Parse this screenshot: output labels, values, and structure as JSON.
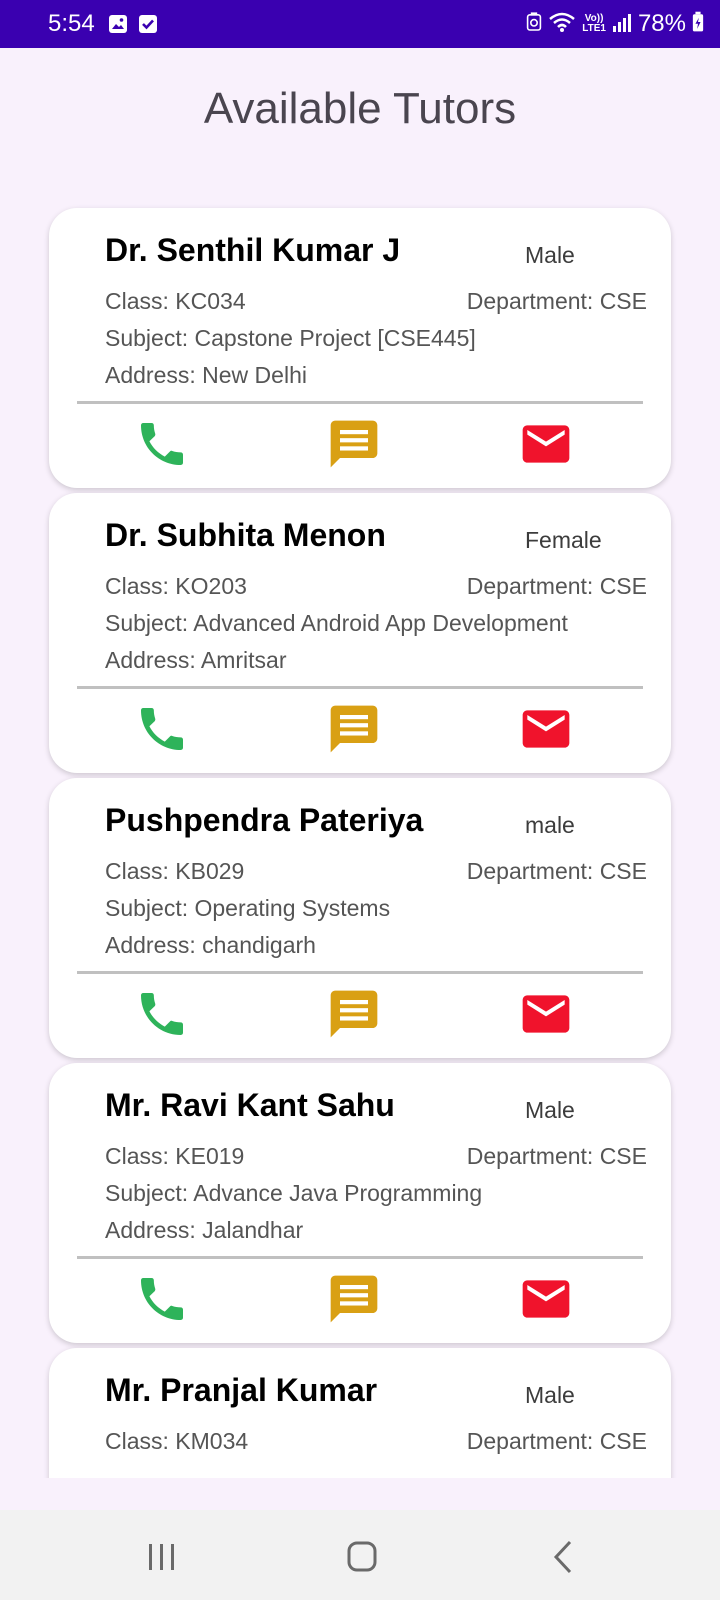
{
  "status_bar": {
    "time": "5:54",
    "left_icons": [
      "image-icon",
      "checkbox-icon"
    ],
    "network_label_top": "Vo))",
    "network_label_bottom": "LTE1",
    "battery": "78%"
  },
  "header": {
    "title": "Available Tutors"
  },
  "colors": {
    "status_bar": "#3a00b0",
    "background": "#f9f1fc",
    "call": "#2eb35a",
    "message": "#d9a014",
    "email": "#f0132c"
  },
  "tutors": [
    {
      "name": "Dr. Senthil Kumar J",
      "gender": "Male",
      "class": "Class: KC034",
      "department": "Department: CSE",
      "subject": "Subject: Capstone Project [CSE445]",
      "address": "Address: New Delhi"
    },
    {
      "name": "Dr. Subhita Menon",
      "gender": "Female",
      "class": "Class: KO203",
      "department": "Department: CSE",
      "subject": "Subject: Advanced Android App Development",
      "address": "Address: Amritsar"
    },
    {
      "name": "Pushpendra Pateriya",
      "gender": "male",
      "class": "Class: KB029",
      "department": "Department: CSE",
      "subject": "Subject: Operating Systems",
      "address": "Address: chandigarh"
    },
    {
      "name": "Mr. Ravi Kant Sahu",
      "gender": "Male",
      "class": "Class: KE019",
      "department": "Department: CSE",
      "subject": "Subject: Advance Java Programming",
      "address": "Address: Jalandhar"
    },
    {
      "name": "Mr. Pranjal Kumar",
      "gender": "Male",
      "class": "Class: KM034",
      "department": "Department: CSE",
      "subject": "",
      "address": ""
    }
  ],
  "actions": [
    "phone-icon",
    "message-icon",
    "email-icon"
  ],
  "nav": [
    "recent-apps-icon",
    "home-icon",
    "back-icon"
  ]
}
